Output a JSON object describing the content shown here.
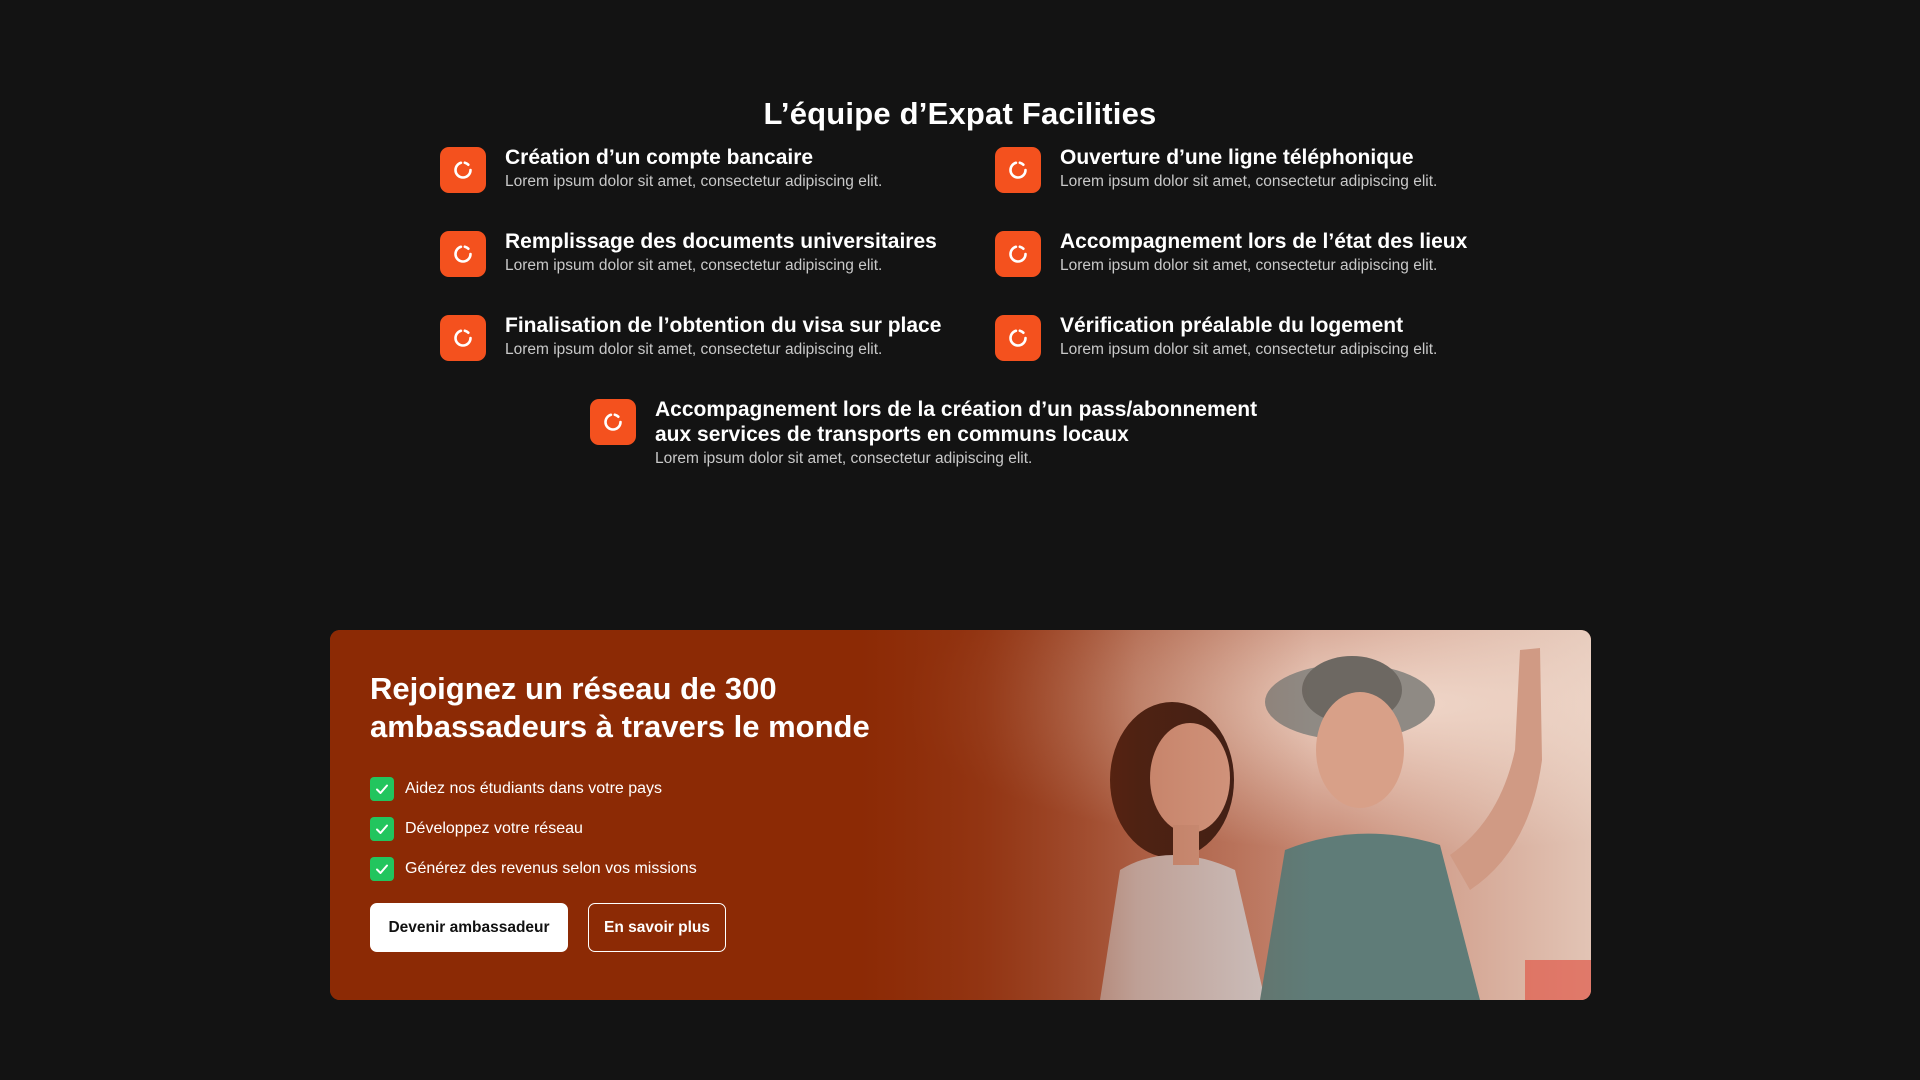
{
  "section": {
    "title": "L’équipe d’Expat Facilities"
  },
  "features": [
    {
      "title": "Création d’un compte bancaire",
      "desc": "Lorem ipsum dolor sit amet, consectetur adipiscing elit.",
      "icon": "loader-icon"
    },
    {
      "title": "Ouverture d’une ligne téléphonique",
      "desc": "Lorem ipsum dolor sit amet, consectetur adipiscing elit.",
      "icon": "loader-icon"
    },
    {
      "title": "Remplissage des documents universitaires",
      "desc": "Lorem ipsum dolor sit amet, consectetur adipiscing elit.",
      "icon": "loader-icon"
    },
    {
      "title": "Accompagnement lors de l’état des lieux",
      "desc": "Lorem ipsum dolor sit amet, consectetur adipiscing elit.",
      "icon": "loader-icon"
    },
    {
      "title": "Finalisation de l’obtention du visa sur place",
      "desc": "Lorem ipsum dolor sit amet, consectetur adipiscing elit.",
      "icon": "loader-icon"
    },
    {
      "title": "Vérification préalable du logement",
      "desc": "Lorem ipsum dolor sit amet, consectetur adipiscing elit.",
      "icon": "loader-icon"
    },
    {
      "title": "Accompagnement lors de la création d’un pass/abonnement aux services de transports en communs locaux",
      "desc": "Lorem ipsum dolor sit amet, consectetur adipiscing elit.",
      "icon": "loader-icon"
    }
  ],
  "banner": {
    "title": "Rejoignez un réseau de 300\nambassadeurs à travers le monde",
    "checks": [
      "Aidez nos étudiants dans votre pays",
      "Développez votre réseau",
      "Générez des revenus selon vos missions"
    ],
    "primary_button": "Devenir ambassadeur",
    "secondary_button": "En savoir plus"
  },
  "colors": {
    "background": "#131313",
    "accent": "#f4511e",
    "banner": "#8c2a05",
    "check": "#22c55e"
  }
}
